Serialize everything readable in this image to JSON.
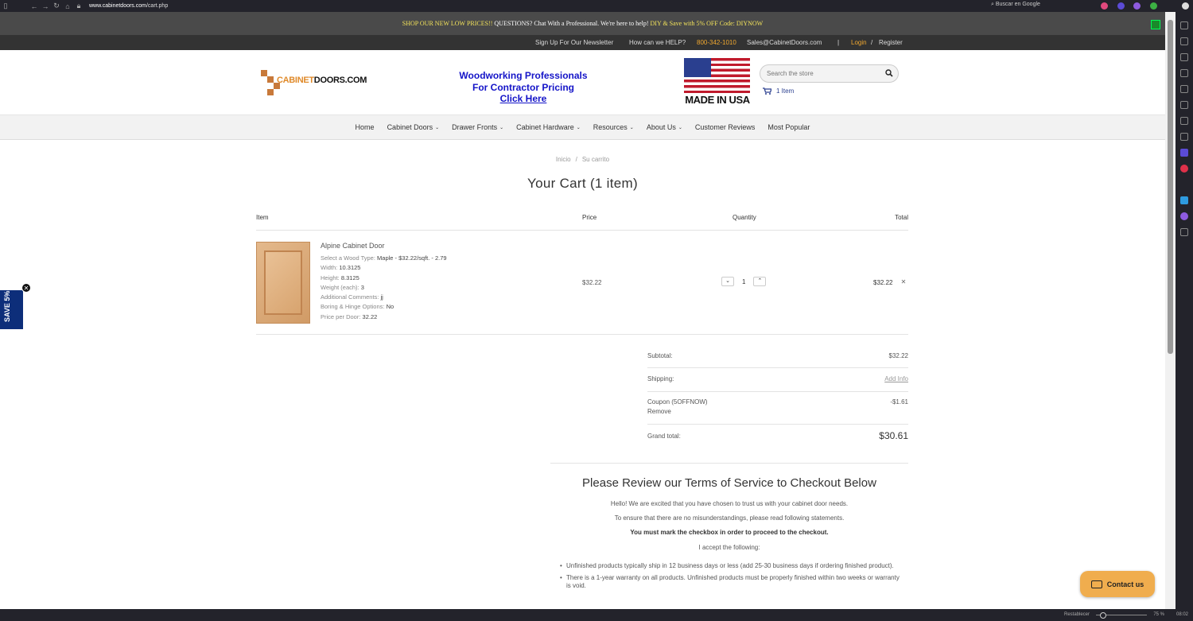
{
  "browser": {
    "url_host": "www.cabinetdoors.com",
    "url_path": "/cart.php",
    "search_placeholder": "Buscar en Google",
    "restore_label": "Restablecer",
    "zoom": "75 %",
    "clock": "08:02"
  },
  "promo": {
    "part1": "SHOP OUR NEW LOW PRICES!!",
    "part2": " QUESTIONS? Chat With a Professional. We're here to help! ",
    "part3": "DIY & Save with 5% OFF Code: DIYNOW"
  },
  "utility": {
    "newsletter": "Sign Up For Our Newsletter",
    "help": "How can we HELP?",
    "phone": "800-342-1010",
    "email": "Sales@CabinetDoors.com",
    "divider": "|",
    "login": "Login",
    "slash": "/",
    "register": "Register"
  },
  "header": {
    "logo_a": "CABINET",
    "logo_b": "DOORS.COM",
    "pro_line1": "Woodworking Professionals",
    "pro_line2": "For Contractor Pricing",
    "pro_line3": "Click Here",
    "made_in": "MADE IN USA",
    "search_placeholder": "Search the store",
    "cart_count": "1 Item"
  },
  "nav": {
    "home": "Home",
    "cabinet_doors": "Cabinet Doors",
    "drawer_fronts": "Drawer Fronts",
    "cabinet_hardware": "Cabinet Hardware",
    "resources": "Resources",
    "about": "About Us",
    "reviews": "Customer Reviews",
    "popular": "Most Popular"
  },
  "breadcrumb": {
    "home": "Inicio",
    "sep": "/",
    "current": "Su carrito"
  },
  "cart": {
    "title": "Your Cart (1 item)",
    "col_item": "Item",
    "col_price": "Price",
    "col_qty": "Quantity",
    "col_total": "Total",
    "product_name": "Alpine Cabinet Door",
    "opt1_k": "Select a Wood Type:",
    "opt1_v": "Maple - $32.22/sqft. - 2.79",
    "opt2_k": "Width:",
    "opt2_v": "10.3125",
    "opt3_k": "Height:",
    "opt3_v": "8.3125",
    "opt4_k": "Weight (each):",
    "opt4_v": "3",
    "opt5_k": "Additional Comments:",
    "opt5_v": "jj",
    "opt6_k": "Boring & Hinge Options:",
    "opt6_v": "No",
    "opt7_k": "Price per Door:",
    "opt7_v": "32.22",
    "price": "$32.22",
    "qty": "1",
    "line_total": "$32.22"
  },
  "summary": {
    "subtotal_label": "Subtotal:",
    "subtotal_value": "$32.22",
    "shipping_label": "Shipping:",
    "shipping_value": "Add Info",
    "coupon_label": "Coupon (5OFFNOW)",
    "coupon_remove": "Remove",
    "coupon_value": "-$1.61",
    "grand_label": "Grand total:",
    "grand_value": "$30.61"
  },
  "terms": {
    "title": "Please Review our Terms of Service to Checkout Below",
    "p1": "Hello! We are excited that you have chosen to trust us with your cabinet door needs.",
    "p2": "To ensure that there are no misunderstandings, please read following statements.",
    "p3": "You must mark the checkbox in order to proceed to the checkout.",
    "p4": "I accept the following:",
    "li1": "Unfinished products typically ship in 12 business days or less (add 25-30 business days if ordering finished product).",
    "li2": "There is a 1-year warranty on all products. Unfinished products must be properly finished within two weeks or warranty is void."
  },
  "widgets": {
    "save_tab": "SAVE 5%",
    "contact": "Contact us"
  },
  "colors": {
    "promo_bg": "#4a4a4a",
    "accent_orange": "#f0a830",
    "pro_link_blue": "#1414c8",
    "contact_bg": "#f0ad4e",
    "save_tab_bg": "#0d2e7a"
  }
}
